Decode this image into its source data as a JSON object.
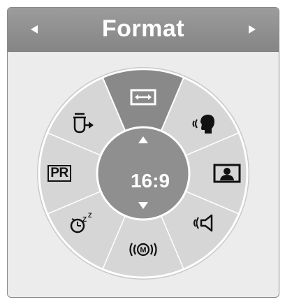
{
  "header": {
    "title": "Format",
    "left_arrow": "triangle-left-icon",
    "right_arrow": "triangle-right-icon"
  },
  "wheel": {
    "center_value": "16:9",
    "selected_item": "aspect-ratio",
    "items": [
      {
        "name": "aspect-ratio",
        "icon": "double-arrow-box-icon"
      },
      {
        "name": "voice",
        "icon": "speaking-head-icon"
      },
      {
        "name": "picture",
        "icon": "person-picture-icon"
      },
      {
        "name": "sound",
        "icon": "speaker-icon"
      },
      {
        "name": "audio-mode",
        "icon": "m-signal-icon"
      },
      {
        "name": "sleep-timer",
        "icon": "sleep-timer-icon"
      },
      {
        "name": "pr-list",
        "label": "PR"
      },
      {
        "name": "input",
        "icon": "input-plug-icon"
      }
    ]
  },
  "colors": {
    "header": "#919191",
    "panel_bg": "#ececec",
    "wheel_outer": "#d4d4d4",
    "selected_segment": "#898989",
    "center_circle": "#8f8f8f",
    "text_white": "#ffffff",
    "icon": "#111111"
  }
}
